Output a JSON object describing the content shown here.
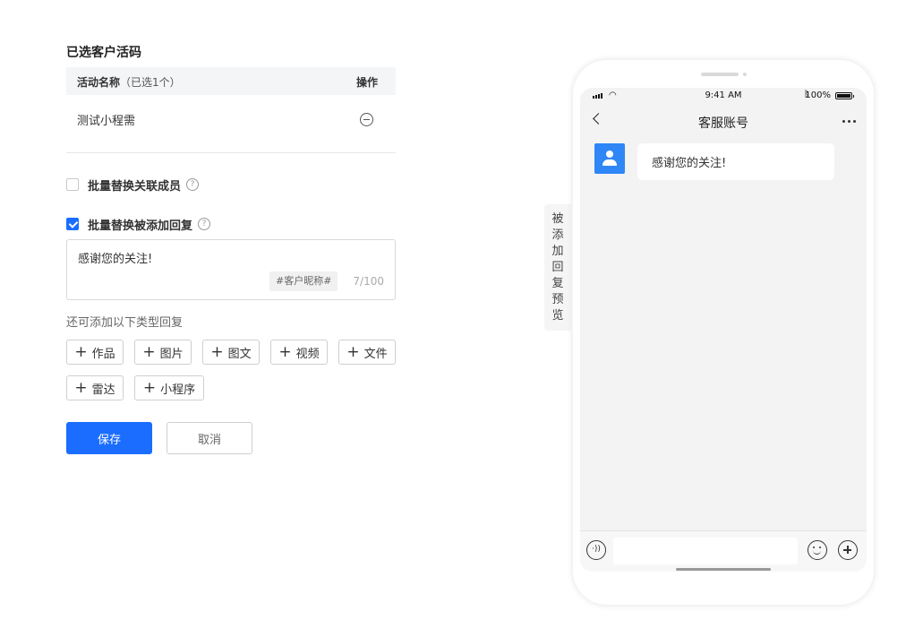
{
  "section": {
    "title": "已选客户活码"
  },
  "table": {
    "header_name": "活动名称",
    "header_count": "（已选1个）",
    "header_action": "操作",
    "rows": [
      {
        "name": "测试小程需"
      }
    ]
  },
  "options": {
    "replace_members_label": "批量替换关联成员",
    "replace_members_checked": false,
    "replace_reply_label": "批量替换被添加回复",
    "replace_reply_checked": true,
    "help_glyph": "?"
  },
  "reply": {
    "text": "感谢您的关注!",
    "nickname_tag": "#客户昵称#",
    "char_count": "7/100"
  },
  "hint": "还可添加以下类型回复",
  "add_buttons": [
    "作品",
    "图片",
    "图文",
    "视频",
    "文件",
    "雷达",
    "小程序"
  ],
  "actions": {
    "save": "保存",
    "cancel": "取消"
  },
  "side_tab": "被添加回复预览",
  "phone": {
    "time": "9:41 AM",
    "battery": "100%",
    "chat_title": "客服账号",
    "message": "感谢您的关注!"
  },
  "colors": {
    "primary": "#1a6dff",
    "avatar": "#2f86f6"
  }
}
